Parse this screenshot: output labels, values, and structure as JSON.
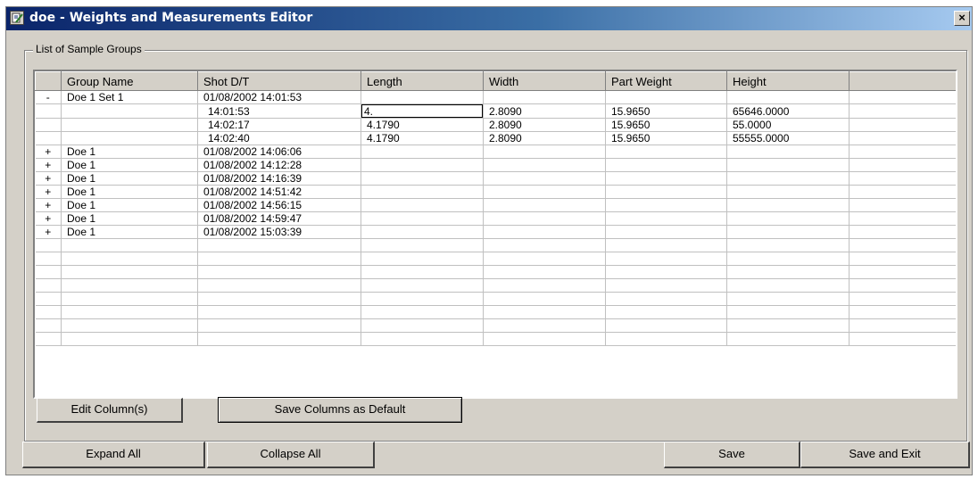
{
  "window": {
    "title": "doe - Weights and Measurements Editor",
    "close_label": "×"
  },
  "group": {
    "legend": "List of Sample Groups"
  },
  "table": {
    "columns": [
      "",
      "Group Name",
      "Shot D/T",
      "Length",
      "Width",
      "Part Weight",
      "Height",
      ""
    ],
    "rows": [
      {
        "exp": "-",
        "name": "Doe 1 Set 1",
        "shot": "01/08/2002 14:01:53",
        "length": "",
        "width": "",
        "weight": "",
        "height": ""
      },
      {
        "exp": "",
        "name": "",
        "shot": "14:01:53",
        "length": "4.",
        "width": "2.8090",
        "weight": "15.9650",
        "height": "65646.0000"
      },
      {
        "exp": "",
        "name": "",
        "shot": "14:02:17",
        "length": "4.1790",
        "width": "2.8090",
        "weight": "15.9650",
        "height": "55.0000"
      },
      {
        "exp": "",
        "name": "",
        "shot": "14:02:40",
        "length": "4.1790",
        "width": "2.8090",
        "weight": "15.9650",
        "height": "55555.0000"
      },
      {
        "exp": "+",
        "name": "Doe 1",
        "shot": "01/08/2002 14:06:06",
        "length": "",
        "width": "",
        "weight": "",
        "height": ""
      },
      {
        "exp": "+",
        "name": "Doe 1",
        "shot": "01/08/2002 14:12:28",
        "length": "",
        "width": "",
        "weight": "",
        "height": ""
      },
      {
        "exp": "+",
        "name": "Doe 1",
        "shot": "01/08/2002 14:16:39",
        "length": "",
        "width": "",
        "weight": "",
        "height": ""
      },
      {
        "exp": "+",
        "name": "Doe 1",
        "shot": "01/08/2002 14:51:42",
        "length": "",
        "width": "",
        "weight": "",
        "height": ""
      },
      {
        "exp": "+",
        "name": "Doe 1",
        "shot": "01/08/2002 14:56:15",
        "length": "",
        "width": "",
        "weight": "",
        "height": ""
      },
      {
        "exp": "+",
        "name": "Doe 1",
        "shot": "01/08/2002 14:59:47",
        "length": "",
        "width": "",
        "weight": "",
        "height": ""
      },
      {
        "exp": "+",
        "name": "Doe 1",
        "shot": "01/08/2002 15:03:39",
        "length": "",
        "width": "",
        "weight": "",
        "height": ""
      }
    ],
    "empty_rows": 8,
    "editing_value": "4."
  },
  "buttons": {
    "edit_columns": "Edit Column(s)",
    "save_columns_default": "Save Columns as Default",
    "expand_all": "Expand All",
    "collapse_all": "Collapse All",
    "save": "Save",
    "save_and_exit": "Save and Exit"
  },
  "icons": {
    "app": "edit-document-icon",
    "close": "close-icon"
  },
  "colors": {
    "titlebar_start": "#0a246a",
    "titlebar_end": "#a6caf0",
    "face": "#d4d0c8"
  }
}
